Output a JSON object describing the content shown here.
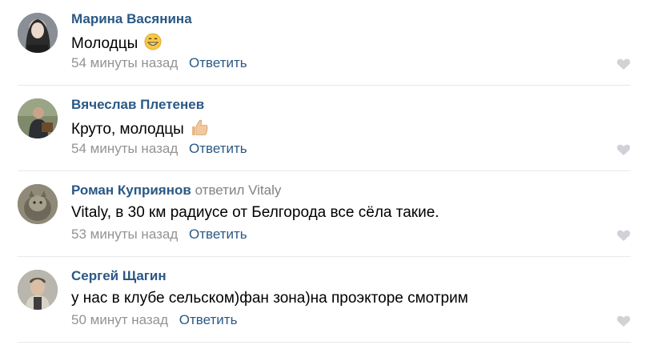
{
  "comments": [
    {
      "author": "Марина Васянина",
      "reply_to_prefix": "",
      "reply_to_name": "",
      "text": "Молодцы",
      "emoji_icon": "grinning-face-icon",
      "time": "54 минуты назад",
      "reply_label": "Ответить",
      "like_icon": "heart-icon"
    },
    {
      "author": "Вячеслав Плетенев",
      "reply_to_prefix": "",
      "reply_to_name": "",
      "text": "Круто, молодцы",
      "emoji_icon": "thumbs-up-icon",
      "time": "54 минуты назад",
      "reply_label": "Ответить",
      "like_icon": "heart-icon"
    },
    {
      "author": "Роман Куприянов",
      "reply_to_prefix": "ответил",
      "reply_to_name": "Vitaly",
      "text": "Vitaly, в 30 км радиусе от Белгорода все сёла такие.",
      "emoji_icon": "",
      "time": "53 минуты назад",
      "reply_label": "Ответить",
      "like_icon": "heart-icon"
    },
    {
      "author": "Сергей Щагин",
      "reply_to_prefix": "",
      "reply_to_name": "",
      "text": "у нас в клубе сельском)фан зона)на проэкторе смотрим",
      "emoji_icon": "",
      "time": "50 минут назад",
      "reply_label": "Ответить",
      "like_icon": "heart-icon"
    }
  ],
  "colors": {
    "author_link": "#2a5885",
    "meta_gray": "#939393",
    "divider": "#e7e8ec",
    "like_gray": "#cfd2d6"
  }
}
